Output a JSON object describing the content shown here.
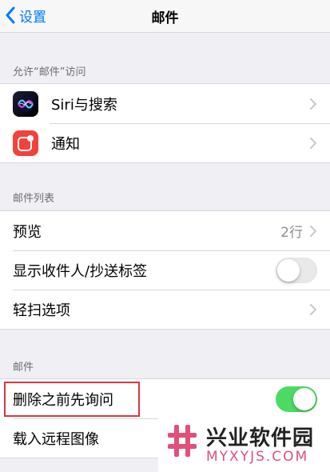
{
  "nav": {
    "back_label": "设置",
    "title": "邮件"
  },
  "access_section": {
    "header": "允许“邮件”访问",
    "items": [
      {
        "label": "Siri与搜索",
        "icon": "siri-icon"
      },
      {
        "label": "通知",
        "icon": "notification-icon"
      }
    ]
  },
  "list_section": {
    "header": "邮件列表",
    "preview": {
      "label": "预览",
      "value": "2行"
    },
    "show_to_cc": {
      "label": "显示收件人/抄送标签",
      "on": false
    },
    "swipe": {
      "label": "轻扫选项"
    }
  },
  "mail_section": {
    "header": "邮件",
    "ask_before_delete": {
      "label": "删除之前先询问",
      "on": true
    },
    "load_remote": {
      "label": "载入远程图像"
    }
  },
  "watermark": {
    "name": "兴业软件园",
    "url": "MYXYJS.COM"
  },
  "colors": {
    "accent": "#007aff",
    "toggle_on": "#4cd964",
    "highlight": "#d9363e",
    "notification": "#f2423b",
    "watermark_accent": "#e0507a"
  }
}
